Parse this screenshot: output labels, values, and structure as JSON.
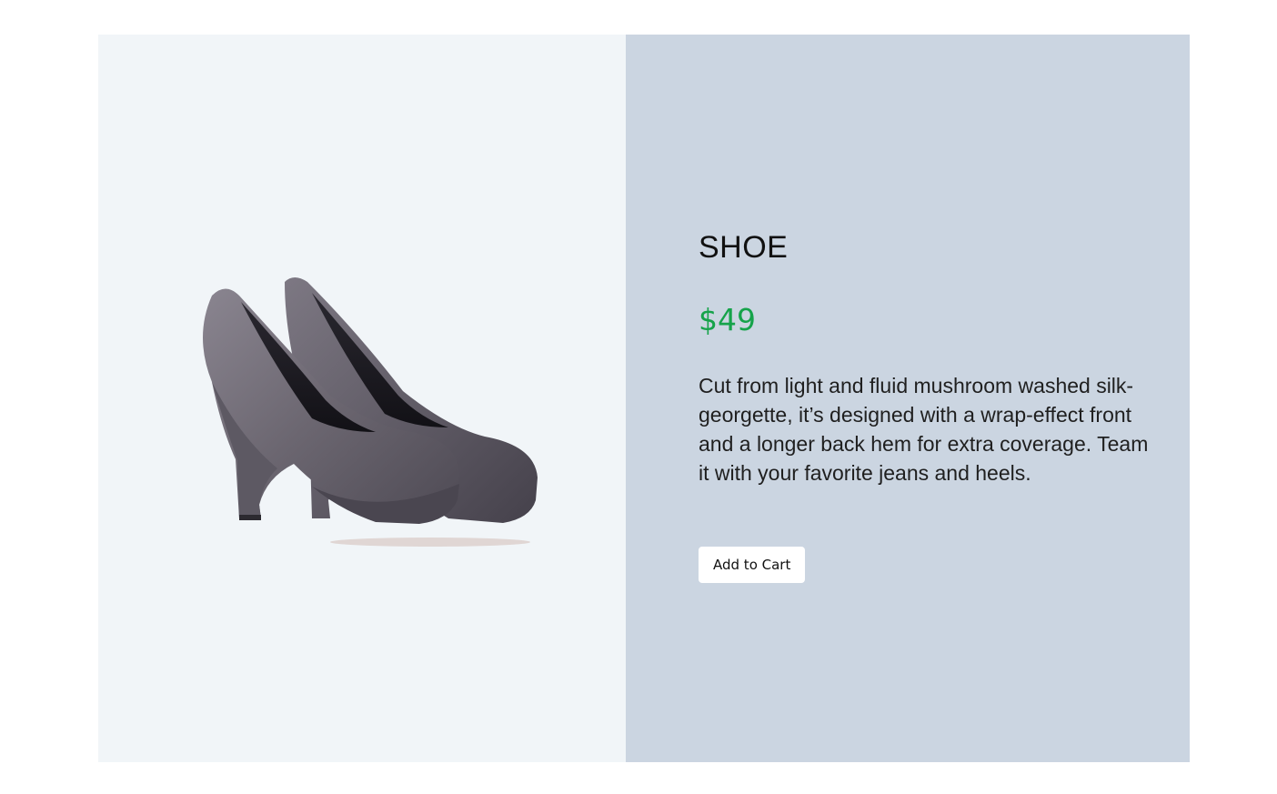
{
  "product": {
    "title": "SHOE",
    "price": "$49",
    "description": "Cut from light and fluid mushroom washed silk-georgette, it’s designed with a wrap-effect front and a longer back hem for extra coverage. Team it with your favorite jeans and heels.",
    "add_to_cart_label": "Add to Cart",
    "image_alt": "Grey suede platform high heels"
  },
  "colors": {
    "image_panel_bg": "#f1f5f8",
    "info_panel_bg": "#cbd5e1",
    "price": "#16a34a",
    "button_bg": "#ffffff"
  }
}
